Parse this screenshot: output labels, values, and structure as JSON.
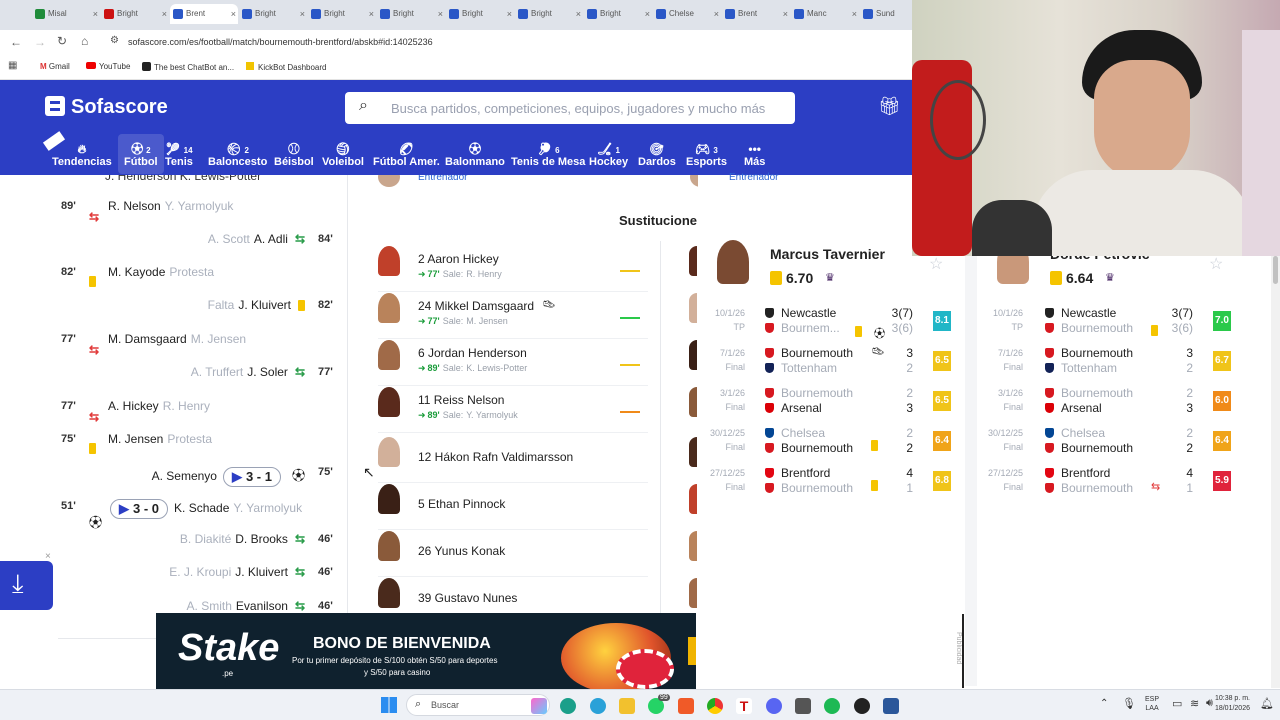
{
  "browser": {
    "tabs": [
      "Misal",
      "Bright",
      "Brent",
      "Bright",
      "Bright",
      "Bright",
      "Bright",
      "Bright",
      "Bright",
      "Chelse",
      "Brent",
      "Manc",
      "Sund"
    ],
    "url": "sofascore.com/es/football/match/bournemouth-brentford/abskb#id:14025236",
    "bookmarks": [
      "Gmail",
      "YouTube",
      "The best ChatBot an...",
      "KickBot Dashboard"
    ]
  },
  "site": {
    "logo": "Sofascore",
    "search_placeholder": "Busca partidos, competiciones, equipos, jugadores y mucho más",
    "nav": [
      {
        "label": "Tendencias",
        "icon": "flame-icon",
        "count": ""
      },
      {
        "label": "Fútbol",
        "icon": "football-icon",
        "count": "2"
      },
      {
        "label": "Tenis",
        "icon": "tennis-icon",
        "count": "14"
      },
      {
        "label": "Baloncesto",
        "icon": "basketball-icon",
        "count": "2"
      },
      {
        "label": "Béisbol",
        "icon": "baseball-icon",
        "count": ""
      },
      {
        "label": "Voleibol",
        "icon": "volleyball-icon",
        "count": ""
      },
      {
        "label": "Fútbol Amer.",
        "icon": "american-football-icon",
        "count": ""
      },
      {
        "label": "Balonmano",
        "icon": "handball-icon",
        "count": ""
      },
      {
        "label": "Tenis de Mesa",
        "icon": "table-tennis-icon",
        "count": "6"
      },
      {
        "label": "Hockey",
        "icon": "hockey-icon",
        "count": "1"
      },
      {
        "label": "Dardos",
        "icon": "darts-icon",
        "count": ""
      },
      {
        "label": "Esports",
        "icon": "esports-icon",
        "count": "3"
      },
      {
        "label": "Más",
        "icon": "more-icon",
        "count": ""
      }
    ]
  },
  "timeline": {
    "top_partial": "J. Henderson K. Lewis-Potter",
    "events": [
      {
        "side": "home",
        "minute": "89'",
        "type": "sub",
        "player": "R. Nelson",
        "secondary": "Y. Yarmolyuk"
      },
      {
        "side": "away",
        "minute": "84'",
        "type": "sub",
        "player": "A. Adli",
        "secondary": "A. Scott"
      },
      {
        "side": "home",
        "minute": "82'",
        "type": "yellow",
        "player": "M. Kayode",
        "secondary": "Protesta"
      },
      {
        "side": "away",
        "minute": "82'",
        "type": "yellow",
        "player": "J. Kluivert",
        "secondary": "Falta"
      },
      {
        "side": "home",
        "minute": "77'",
        "type": "sub",
        "player": "M. Damsgaard",
        "secondary": "M. Jensen"
      },
      {
        "side": "away",
        "minute": "77'",
        "type": "sub",
        "player": "J. Soler",
        "secondary": "A. Truffert"
      },
      {
        "side": "home",
        "minute": "77'",
        "type": "sub",
        "player": "A. Hickey",
        "secondary": "R. Henry"
      },
      {
        "side": "home",
        "minute": "75'",
        "type": "yellow",
        "player": "M. Jensen",
        "secondary": "Protesta"
      },
      {
        "side": "away",
        "minute": "75'",
        "type": "goal",
        "player": "A. Semenyo",
        "secondary": "",
        "score": "3 - 1"
      },
      {
        "side": "home",
        "minute": "51'",
        "type": "goal",
        "player": "K. Schade",
        "secondary": "Y. Yarmolyuk",
        "score": "3 - 0"
      },
      {
        "side": "away",
        "minute": "46'",
        "type": "sub",
        "player": "D. Brooks",
        "secondary": "B. Diakité"
      },
      {
        "side": "away",
        "minute": "46'",
        "type": "sub",
        "player": "J. Kluivert",
        "secondary": "E. J. Kroupi"
      },
      {
        "side": "away",
        "minute": "46'",
        "type": "sub",
        "player": "Evanilson",
        "secondary": "A. Smith"
      }
    ]
  },
  "lineups": {
    "coach_label": "Entrenador",
    "subs_title": "Sustitucione",
    "subs": [
      {
        "name": "2 Aaron Hickey",
        "minute": "77'",
        "out_label": "Sale:",
        "out": "R. Henry",
        "line_color": "#f0c419"
      },
      {
        "name": "24 Mikkel Damsgaard",
        "minute": "77'",
        "out_label": "Sale:",
        "out": "M. Jensen",
        "line_color": "#2ac94a"
      },
      {
        "name": "6 Jordan Henderson",
        "minute": "89'",
        "out_label": "Sale:",
        "out": "K. Lewis-Potter",
        "line_color": "#f0c419"
      },
      {
        "name": "11 Reiss Nelson",
        "minute": "89'",
        "out_label": "Sale:",
        "out": "Y. Yarmolyuk",
        "line_color": "#f08a19"
      },
      {
        "name": "12 Hákon Rafn Valdimarsson",
        "minute": "",
        "out_label": "",
        "out": "",
        "line_color": ""
      },
      {
        "name": "5 Ethan Pinnock",
        "minute": "",
        "out_label": "",
        "out": "",
        "line_color": ""
      },
      {
        "name": "26 Yunus Konak",
        "minute": "",
        "out_label": "",
        "out": "",
        "line_color": ""
      },
      {
        "name": "39 Gustavo Nunes",
        "minute": "",
        "out_label": "",
        "out": "",
        "line_color": ""
      }
    ]
  },
  "player_cards": [
    {
      "name": "Marcus Tavernier",
      "rating": "6.70",
      "rows": [
        {
          "date": "10/1/26",
          "status": "TP",
          "home": "Newcastle",
          "away": "Bournem...",
          "hs": "3(7)",
          "as": "3(6)",
          "home_bold": true,
          "rating": "8.1",
          "rcolor": "#21b6c7"
        },
        {
          "date": "7/1/26",
          "status": "Final",
          "home": "Bournemouth",
          "away": "Tottenham",
          "hs": "3",
          "as": "2",
          "home_bold": true,
          "rating": "6.5",
          "rcolor": "#f0c419"
        },
        {
          "date": "3/1/26",
          "status": "Final",
          "home": "Bournemouth",
          "away": "Arsenal",
          "hs": "2",
          "as": "3",
          "home_bold": false,
          "rating": "6.5",
          "rcolor": "#f0c419"
        },
        {
          "date": "30/12/25",
          "status": "Final",
          "home": "Chelsea",
          "away": "Bournemouth",
          "hs": "2",
          "as": "2",
          "home_bold": false,
          "rating": "6.4",
          "rcolor": "#f0a419"
        },
        {
          "date": "27/12/25",
          "status": "Final",
          "home": "Brentford",
          "away": "Bournemouth",
          "hs": "4",
          "as": "1",
          "home_bold": true,
          "rating": "6.8",
          "rcolor": "#f0c419"
        }
      ]
    },
    {
      "name": "Đorđe Petrović",
      "rating": "6.64",
      "rows": [
        {
          "date": "10/1/26",
          "status": "TP",
          "home": "Newcastle",
          "away": "Bournemouth",
          "hs": "3(7)",
          "as": "3(6)",
          "home_bold": true,
          "rating": "7.0",
          "rcolor": "#2ac94a"
        },
        {
          "date": "7/1/26",
          "status": "Final",
          "home": "Bournemouth",
          "away": "Tottenham",
          "hs": "3",
          "as": "2",
          "home_bold": true,
          "rating": "6.7",
          "rcolor": "#f0c419"
        },
        {
          "date": "3/1/26",
          "status": "Final",
          "home": "Bournemouth",
          "away": "Arsenal",
          "hs": "2",
          "as": "3",
          "home_bold": false,
          "rating": "6.0",
          "rcolor": "#f08a19"
        },
        {
          "date": "30/12/25",
          "status": "Final",
          "home": "Chelsea",
          "away": "Bournemouth",
          "hs": "2",
          "as": "2",
          "home_bold": false,
          "rating": "6.4",
          "rcolor": "#f0a419"
        },
        {
          "date": "27/12/25",
          "status": "Final",
          "home": "Brentford",
          "away": "Bournemouth",
          "hs": "4",
          "as": "1",
          "home_bold": true,
          "rating": "5.9",
          "rcolor": "#e0233b"
        }
      ]
    }
  ],
  "ad": {
    "brand": "Stake",
    "brand_sub": ".pe",
    "headline": "BONO DE BIENVENIDA",
    "body_line1": "Por tu primer depósito de S/100 obtén S/50 para deportes",
    "body_line2": "y S/50 para casino",
    "side_label": "Publicidad"
  },
  "taskbar": {
    "search_label": "Buscar",
    "lang": "ESP",
    "lang2": "LAA",
    "time": "10:38 p. m.",
    "date": "18/01/2026",
    "badge": "99"
  }
}
